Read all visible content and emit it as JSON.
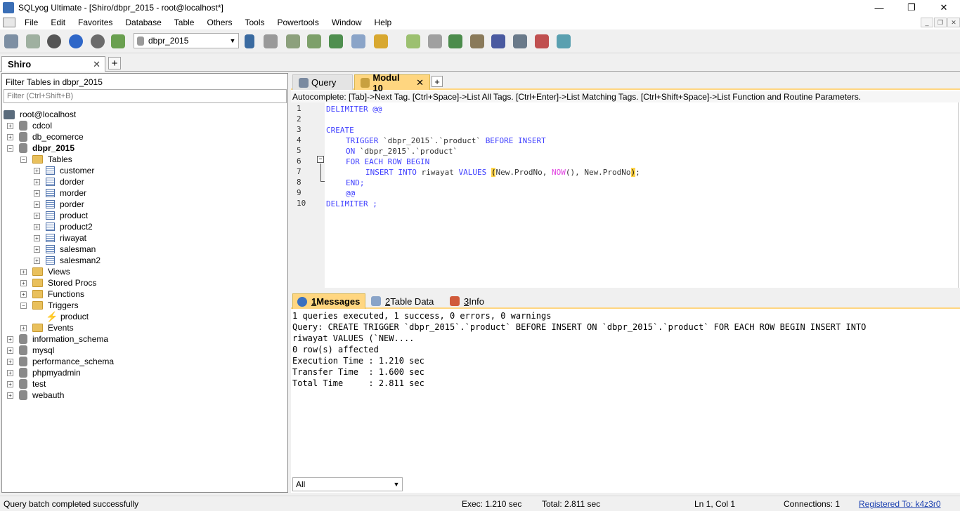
{
  "window": {
    "title": "SQLyog Ultimate - [Shiro/dbpr_2015 - root@localhost*]",
    "controls": {
      "minimize": "—",
      "restore": "❐",
      "close": "✕"
    }
  },
  "menu": [
    "File",
    "Edit",
    "Favorites",
    "Database",
    "Table",
    "Others",
    "Tools",
    "Powertools",
    "Window",
    "Help"
  ],
  "mdi_controls": {
    "minimize": "_",
    "restore": "❐",
    "close": "✕"
  },
  "toolbar": {
    "db_select": "dbpr_2015",
    "icons": [
      "connect-icon",
      "new-query-icon",
      "execute-icon",
      "execute-all-icon",
      "stop-icon",
      "refresh-icon",
      "user-manager-icon",
      "create-db-icon",
      "create-table-icon",
      "alter-table-icon",
      "insert-data-icon",
      "table-data-icon",
      "schema-icon",
      "backup-icon",
      "restore-icon",
      "import-icon",
      "export-icon",
      "sync-icon",
      "job-agent-icon",
      "schema-designer-icon",
      "query-builder-icon",
      "notifications-icon",
      "data-search-icon"
    ]
  },
  "connection_tab": {
    "label": "Shiro",
    "close": "✕",
    "add": "+"
  },
  "object_browser": {
    "filter_label": "Filter Tables in dbpr_2015",
    "filter_placeholder": "Filter (Ctrl+Shift+B)",
    "root": "root@localhost",
    "items": [
      {
        "label": "cdcol"
      },
      {
        "label": "db_ecomerce"
      },
      {
        "label": "dbpr_2015"
      },
      {
        "label": "Tables"
      },
      {
        "label": "customer"
      },
      {
        "label": "dorder"
      },
      {
        "label": "morder"
      },
      {
        "label": "porder"
      },
      {
        "label": "product"
      },
      {
        "label": "product2"
      },
      {
        "label": "riwayat"
      },
      {
        "label": "salesman"
      },
      {
        "label": "salesman2"
      },
      {
        "label": "Views"
      },
      {
        "label": "Stored Procs"
      },
      {
        "label": "Functions"
      },
      {
        "label": "Triggers"
      },
      {
        "label": "product"
      },
      {
        "label": "Events"
      },
      {
        "label": "information_schema"
      },
      {
        "label": "mysql"
      },
      {
        "label": "performance_schema"
      },
      {
        "label": "phpmyadmin"
      },
      {
        "label": "test"
      },
      {
        "label": "webauth"
      }
    ]
  },
  "query_tabs": {
    "query": "Query",
    "active": "Modul 10",
    "close": "✕",
    "add": "+"
  },
  "autocomplete_hint": "Autocomplete: [Tab]->Next Tag. [Ctrl+Space]->List All Tags. [Ctrl+Enter]->List Matching Tags. [Ctrl+Shift+Space]->List Function and Routine Parameters.",
  "editor": {
    "line_numbers": [
      "1",
      "2",
      "3",
      "4",
      "5",
      "6",
      "7",
      "8",
      "9",
      "10"
    ],
    "lines": {
      "l1_kw": "DELIMITER",
      "l1_rest": " @@",
      "l3_kw": "CREATE",
      "l4_kw1": "TRIGGER",
      "l4_name": " `dbpr_2015`.`product` ",
      "l4_kw2": "BEFORE INSERT",
      "l5_kw": "ON",
      "l5_name": " `dbpr_2015`.`product`",
      "l6_kw": "FOR EACH ROW BEGIN",
      "l7_kw1": "INSERT INTO",
      "l7_t": " riwayat ",
      "l7_kw2": "VALUES",
      "l7_sp": " ",
      "l7_open": "(",
      "l7_a": "New.ProdNo, ",
      "l7_fn": "NOW",
      "l7_b": "(), New.ProdNo",
      "l7_close": ")",
      "l7_semi": ";",
      "l8_kw": "END;",
      "l9_rest": "@@",
      "l10_kw": "DELIMITER",
      "l10_rest": " ;"
    }
  },
  "result_tabs": [
    {
      "num": "1",
      "label": " Messages"
    },
    {
      "num": "2",
      "label": " Table Data"
    },
    {
      "num": "3",
      "label": " Info"
    }
  ],
  "messages": [
    "1 queries executed, 1 success, 0 errors, 0 warnings",
    "",
    "Query: CREATE TRIGGER `dbpr_2015`.`product` BEFORE INSERT ON `dbpr_2015`.`product` FOR EACH ROW BEGIN INSERT INTO",
    "riwayat VALUES (`NEW....",
    "",
    "0 row(s) affected",
    "",
    "Execution Time : 1.210 sec",
    "Transfer Time  : 1.600 sec",
    "Total Time     : 2.811 sec"
  ],
  "message_filter": "All",
  "status": {
    "message": "Query batch completed successfully",
    "exec": "Exec: 1.210 sec",
    "total": "Total: 2.811 sec",
    "position": "Ln 1, Col 1",
    "connections": "Connections: 1",
    "registered": "Registered To: k4z3r0"
  }
}
